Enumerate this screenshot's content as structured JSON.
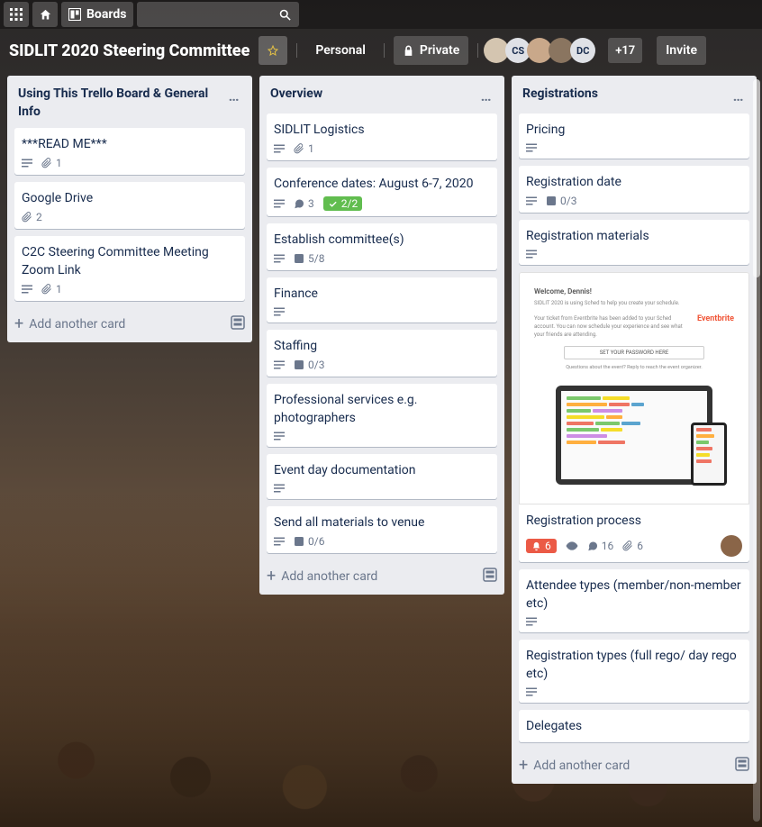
{
  "topbar": {
    "boards_label": "Boards"
  },
  "boardbar": {
    "title": "SIDLIT 2020 Steering Committee",
    "personal_label": "Personal",
    "private_label": "Private",
    "members": [
      {
        "initials": ""
      },
      {
        "initials": "CS"
      },
      {
        "initials": ""
      },
      {
        "initials": ""
      },
      {
        "initials": "DC"
      }
    ],
    "more_count": "+17",
    "invite_label": "Invite"
  },
  "lists": [
    {
      "title": "Using This Trello Board & General Info",
      "cards": [
        {
          "title": "***READ ME***",
          "desc": true,
          "attachments": "1"
        },
        {
          "title": "Google Drive",
          "attachments": "2"
        },
        {
          "title": "C2C Steering Committee Meeting Zoom Link",
          "desc": true,
          "attachments": "1"
        }
      ],
      "add_label": "Add another card"
    },
    {
      "title": "Overview",
      "cards": [
        {
          "title": "SIDLIT Logistics",
          "desc": true,
          "attachments": "1"
        },
        {
          "title": "Conference dates: August 6-7, 2020",
          "desc": true,
          "comments": "3",
          "checklist": "2/2",
          "checklist_done": true
        },
        {
          "title": "Establish committee(s)",
          "desc": true,
          "checklist": "5/8"
        },
        {
          "title": "Finance",
          "desc": true
        },
        {
          "title": "Staffing",
          "desc": true,
          "checklist": "0/3"
        },
        {
          "title": "Professional services e.g. photographers",
          "desc": true
        },
        {
          "title": "Event day documentation",
          "desc": true
        },
        {
          "title": "Send all materials to venue",
          "desc": true,
          "checklist": "0/6"
        }
      ],
      "add_label": "Add another card"
    },
    {
      "title": "Registrations",
      "cards": [
        {
          "title": "Pricing",
          "desc": true
        },
        {
          "title": "Registration date",
          "desc": true,
          "checklist": "0/3"
        },
        {
          "title": "Registration materials",
          "desc": true
        },
        {
          "title": "Registration process",
          "cover": true,
          "notif": "6",
          "watch": true,
          "comments": "16",
          "attachments": "6",
          "member": true,
          "cover_welcome": "Welcome, Dennis!",
          "cover_line1": "SIDLIT 2020 is using Sched to help you create your schedule.",
          "cover_line2": "Your ticket from Eventbrite has been added to your Sched account. You can now schedule your experience and see what your friends are attending.",
          "cover_eb": "Eventbrite",
          "cover_btn": "SET YOUR PASSWORD HERE",
          "cover_q": "Questions about the event? Reply to reach the event organizer."
        },
        {
          "title": "Attendee types (member/non-member etc)",
          "desc": true
        },
        {
          "title": "Registration types (full rego/ day rego etc)",
          "desc": true
        },
        {
          "title": "Delegates"
        }
      ],
      "add_label": "Add another card"
    }
  ]
}
